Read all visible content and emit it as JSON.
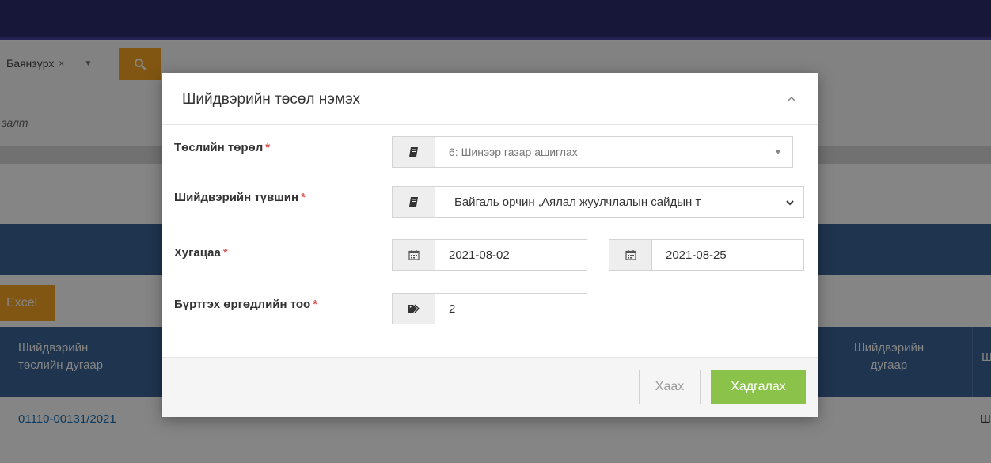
{
  "background": {
    "filter_chip": "Баянзүрх",
    "chip_remove": "×",
    "subhead_text": "залт",
    "excel_button": "Excel",
    "table": {
      "col1_header_line1": "Шийдвэрийн",
      "col1_header_line2": "төслийн дугаар",
      "col2_header_line1": "Шийдвэрийн",
      "col2_header_line2": "дугаар",
      "col3_header": "Ш",
      "row1_col1": "01110-00131/2021",
      "row1_last": "Ш"
    }
  },
  "modal": {
    "title": "Шийдвэрийн төсөл нэмэх",
    "fields": {
      "project_type": {
        "label": "Төслийн төрөл",
        "value": "6: Шинээр газар ашиглах"
      },
      "decision_level": {
        "label": "Шийдвэрийн түвшин",
        "value": "Байгаль орчин ,Аялал жуулчлалын сайдын т"
      },
      "deadline": {
        "label": "Хугацаа",
        "start_date": "2021-08-02",
        "end_date": "2021-08-25"
      },
      "application_count": {
        "label": "Бүртгэх өргөдлийн тоо",
        "value": "2"
      }
    },
    "required_mark": "*",
    "buttons": {
      "close": "Хаах",
      "save": "Хадгалах"
    }
  },
  "colors": {
    "topbar": "#2d2c6d",
    "accent_orange": "#f5a623",
    "table_header": "#3c6496",
    "save_green": "#8bc34a",
    "required_red": "#d9534f"
  },
  "icons": [
    "search-icon",
    "book-icon",
    "calendar-icon",
    "tags-icon",
    "chevron-up-icon",
    "chevron-down-icon",
    "caret-down-icon"
  ]
}
